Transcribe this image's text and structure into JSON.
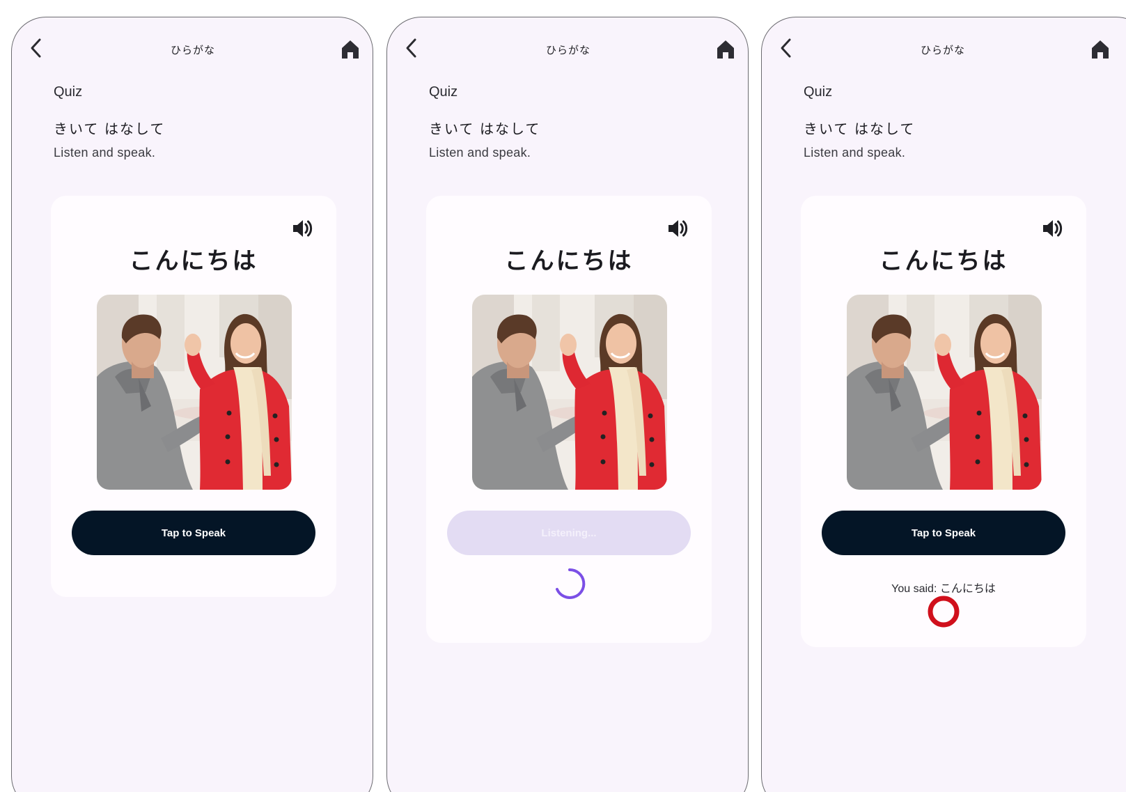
{
  "screens": [
    {
      "app_title": "ひらがな",
      "section_label": "Quiz",
      "quiz_title": "きいて はなして",
      "instruction": "Listen and speak.",
      "word": "こんにちは",
      "button_label": "Tap to Speak",
      "state": "idle"
    },
    {
      "app_title": "ひらがな",
      "section_label": "Quiz",
      "quiz_title": "きいて はなして",
      "instruction": "Listen and speak.",
      "word": "こんにちは",
      "button_label": "Listening...",
      "state": "listening"
    },
    {
      "app_title": "ひらがな",
      "section_label": "Quiz",
      "quiz_title": "きいて はなして",
      "instruction": "Listen and speak.",
      "word": "こんにちは",
      "button_label": "Tap to Speak",
      "state": "result",
      "result_text": "You said: こんにちは",
      "result_mark": "correct-circle-icon"
    }
  ],
  "icons": {
    "back": "chevron-left-icon",
    "home": "home-icon",
    "speaker": "speaker-icon",
    "spinner": "loading-spinner-icon"
  },
  "colors": {
    "background": "#f9f4fc",
    "card": "#fffcff",
    "button": "#041526",
    "button_disabled": "#e3dcf3",
    "spinner": "#7b4fe6",
    "correct_mark": "#d0101c"
  }
}
